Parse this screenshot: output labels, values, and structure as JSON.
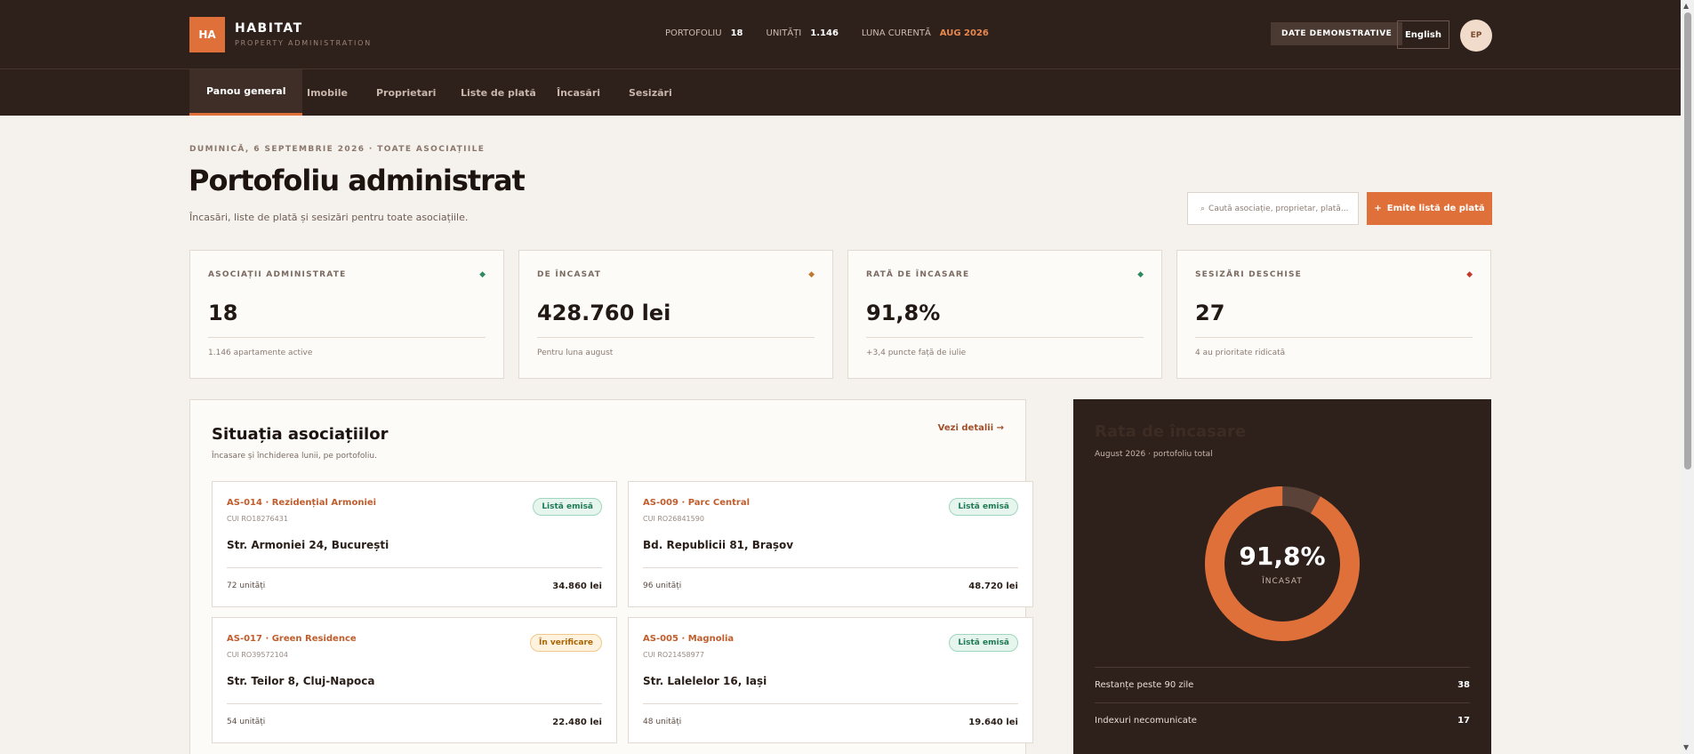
{
  "brand": {
    "logo": "HA",
    "name": "HABITAT",
    "tagline": "PROPERTY ADMINISTRATION"
  },
  "header_stats": [
    {
      "label": "PORTOFOLIU",
      "value": "18"
    },
    {
      "label": "UNITĂȚI",
      "value": "1.146"
    },
    {
      "label": "LUNA CURENTĂ",
      "value": "AUG 2026"
    }
  ],
  "header": {
    "demo_label": "DATE DEMONSTRATIVE",
    "language": "English",
    "avatar": "EP"
  },
  "nav": [
    {
      "label": "Panou general"
    },
    {
      "label": "Imobile"
    },
    {
      "label": "Proprietari"
    },
    {
      "label": "Liste de plată"
    },
    {
      "label": "Încasări"
    },
    {
      "label": "Sesizări"
    }
  ],
  "page": {
    "date_line": "DUMINICĂ, 6 SEPTEMBRIE 2026 · TOATE ASOCIAȚIILE",
    "title": "Portofoliu administrat",
    "subtitle": "Încasări, liste de plată și sesizări pentru toate asociațiile.",
    "search_placeholder": "Caută asociație, proprietar, plată...",
    "issue_button": "Emite listă de plată"
  },
  "kpis": [
    {
      "label": "ASOCIAȚII ADMINISTRATE",
      "value": "18",
      "note": "1.146 apartamente active",
      "color": "#2e8a5f"
    },
    {
      "label": "DE ÎNCASAT",
      "value": "428.760 lei",
      "note": "Pentru luna august",
      "color": "#c0782d"
    },
    {
      "label": "RATĂ DE ÎNCASARE",
      "value": "91,8%",
      "note": "+3,4 puncte față de iulie",
      "color": "#2e8a5f"
    },
    {
      "label": "SESIZĂRI DESCHISE",
      "value": "27",
      "note": "4 au prioritate ridicată",
      "color": "#c0392b"
    }
  ],
  "associations_panel": {
    "title": "Situația asociațiilor",
    "subtitle": "Încasare și închiderea lunii, pe portofoliu.",
    "link": "Vezi detalii →",
    "cards": [
      {
        "code": "AS-014 · Rezidențial Armoniei",
        "cui": "CUI RO18276431",
        "badge": "Listă emisă",
        "address": "Str. Armoniei 24, București",
        "units": "72 unități",
        "amount": "34.860 lei"
      },
      {
        "code": "AS-009 · Parc Central",
        "cui": "CUI RO26841590",
        "badge": "Listă emisă",
        "address": "Bd. Republicii 81, Brașov",
        "units": "96 unități",
        "amount": "48.720 lei"
      },
      {
        "code": "AS-017 · Green Residence",
        "cui": "CUI RO39572104",
        "badge": "În verificare",
        "address": "Str. Teilor 8, Cluj-Napoca",
        "units": "54 unități",
        "amount": "22.480 lei"
      },
      {
        "code": "AS-005 · Magnolia",
        "cui": "CUI RO21458977",
        "badge": "Listă emisă",
        "address": "Str. Lalelelor 16, Iași",
        "units": "48 unități",
        "amount": "19.640 lei"
      }
    ]
  },
  "rate_panel": {
    "title": "Rata de încasare",
    "subtitle": "August 2026 · portofoliu total",
    "percent_label": "91,8%",
    "percent_value": 91.8,
    "caption": "ÎNCASAT",
    "accent": "#e0703a",
    "track": "#5a4238",
    "rows": [
      {
        "label": "Restanțe peste 90 zile",
        "value": "38"
      },
      {
        "label": "Indexuri necomunicate",
        "value": "17"
      }
    ]
  }
}
